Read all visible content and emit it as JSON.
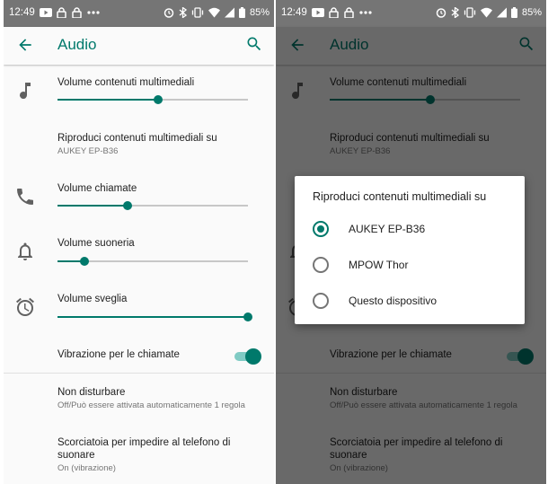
{
  "status_bar": {
    "time": "12:49",
    "battery": "85%"
  },
  "app_bar": {
    "title": "Audio"
  },
  "settings": {
    "media_volume": {
      "label": "Volume contenuti multimediali",
      "level": 0.53
    },
    "play_media_on": {
      "label": "Riproduci contenuti multimediali su",
      "value": "AUKEY EP-B36"
    },
    "call_volume": {
      "label": "Volume chiamate",
      "level": 0.37
    },
    "ring_volume": {
      "label": "Volume suoneria",
      "level": 0.14
    },
    "alarm_volume": {
      "label": "Volume sveglia",
      "level": 1.0
    },
    "vibrate_calls": {
      "label": "Vibrazione per le chiamate",
      "enabled": true
    },
    "do_not_disturb": {
      "label": "Non disturbare",
      "summary": "Off/Può essere attivata automaticamente 1 regola"
    },
    "ring_shortcut": {
      "label_line1": "Scorciatoia per impedire al telefono di",
      "label_line2": "suonare",
      "summary": "On (vibrazione)"
    }
  },
  "dialog": {
    "title": "Riproduci contenuti multimediali su",
    "options": [
      {
        "label": "AUKEY EP-B36",
        "selected": true
      },
      {
        "label": "MPOW Thor",
        "selected": false
      },
      {
        "label": "Questo dispositivo",
        "selected": false
      }
    ]
  },
  "colors": {
    "accent": "#00796b",
    "status_bar": "#757575",
    "background": "#fafafa"
  },
  "icons": [
    "arrow-back-icon",
    "search-icon",
    "music-note-icon",
    "phone-icon",
    "bell-icon",
    "alarm-icon"
  ]
}
